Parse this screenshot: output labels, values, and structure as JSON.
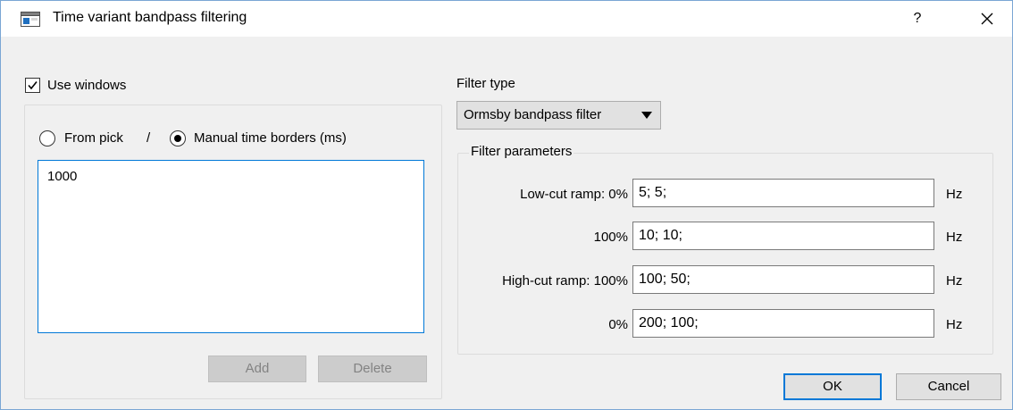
{
  "window": {
    "title": "Time variant bandpass filtering",
    "help_label": "?"
  },
  "left": {
    "use_windows_label": "Use windows",
    "use_windows_checked": true,
    "from_pick_label": "From pick",
    "separator": "/",
    "manual_label": "Manual time borders (ms)",
    "selected_mode": "manual",
    "time_borders_value": "1000",
    "add_label": "Add",
    "delete_label": "Delete"
  },
  "right": {
    "filter_type_label": "Filter type",
    "filter_type_value": "Ormsby bandpass filter",
    "filter_params_label": "Filter parameters",
    "params": [
      {
        "label": "Low-cut ramp: 0%",
        "value": "5; 5;",
        "unit": "Hz"
      },
      {
        "label": "100%",
        "value": "10; 10;",
        "unit": "Hz"
      },
      {
        "label": "High-cut ramp: 100%",
        "value": "100; 50;",
        "unit": "Hz"
      },
      {
        "label": "0%",
        "value": "200; 100;",
        "unit": "Hz"
      }
    ]
  },
  "footer": {
    "ok_label": "OK",
    "cancel_label": "Cancel"
  },
  "icons": {
    "app": "window-app-icon",
    "close": "close-icon",
    "check": "checkmark-icon",
    "dropdown": "chevron-down-icon"
  },
  "colors": {
    "accent": "#0078d7",
    "dialog_bg": "#f0f0f0"
  }
}
